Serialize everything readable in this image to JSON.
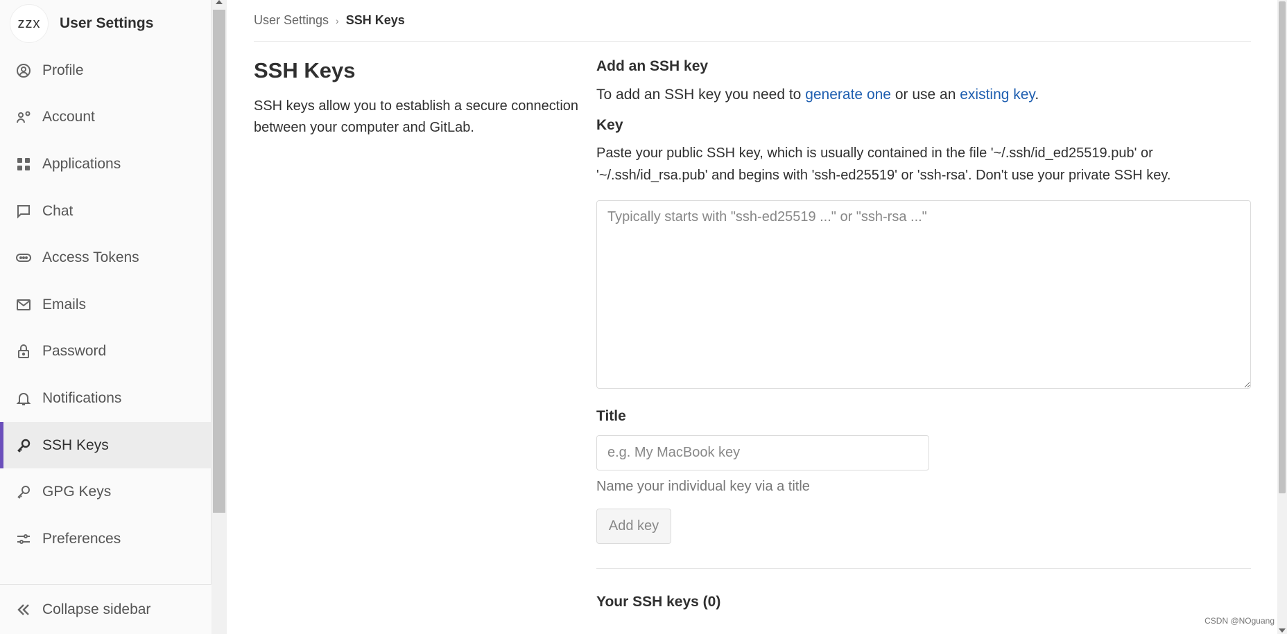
{
  "sidebar": {
    "avatar_text": "zzx",
    "title": "User Settings",
    "items": [
      {
        "label": "Profile",
        "icon": "profile-icon"
      },
      {
        "label": "Account",
        "icon": "account-icon"
      },
      {
        "label": "Applications",
        "icon": "applications-icon"
      },
      {
        "label": "Chat",
        "icon": "chat-icon"
      },
      {
        "label": "Access Tokens",
        "icon": "token-icon"
      },
      {
        "label": "Emails",
        "icon": "mail-icon"
      },
      {
        "label": "Password",
        "icon": "lock-icon"
      },
      {
        "label": "Notifications",
        "icon": "bell-icon"
      },
      {
        "label": "SSH Keys",
        "icon": "key-icon",
        "active": true
      },
      {
        "label": "GPG Keys",
        "icon": "key-icon"
      },
      {
        "label": "Preferences",
        "icon": "preferences-icon"
      }
    ],
    "collapse_label": "Collapse sidebar"
  },
  "breadcrumb": {
    "parent": "User Settings",
    "current": "SSH Keys"
  },
  "section": {
    "title": "SSH Keys",
    "description": "SSH keys allow you to establish a secure connection between your computer and GitLab."
  },
  "form": {
    "heading": "Add an SSH key",
    "intro_prefix": "To add an SSH key you need to ",
    "intro_link1": "generate one",
    "intro_middle": " or use an ",
    "intro_link2": "existing key",
    "intro_suffix": ".",
    "key_label": "Key",
    "key_description": "Paste your public SSH key, which is usually contained in the file '~/.ssh/id_ed25519.pub' or '~/.ssh/id_rsa.pub' and begins with 'ssh-ed25519' or 'ssh-rsa'. Don't use your private SSH key.",
    "key_placeholder": "Typically starts with \"ssh-ed25519 ...\" or \"ssh-rsa ...\"",
    "title_label": "Title",
    "title_placeholder": "e.g. My MacBook key",
    "title_hint": "Name your individual key via a title",
    "add_button": "Add key",
    "your_keys": "Your SSH keys (0)"
  },
  "watermark": "CSDN @NOguang",
  "colors": {
    "accent": "#6b4fbb",
    "link": "#1f5fb0"
  }
}
